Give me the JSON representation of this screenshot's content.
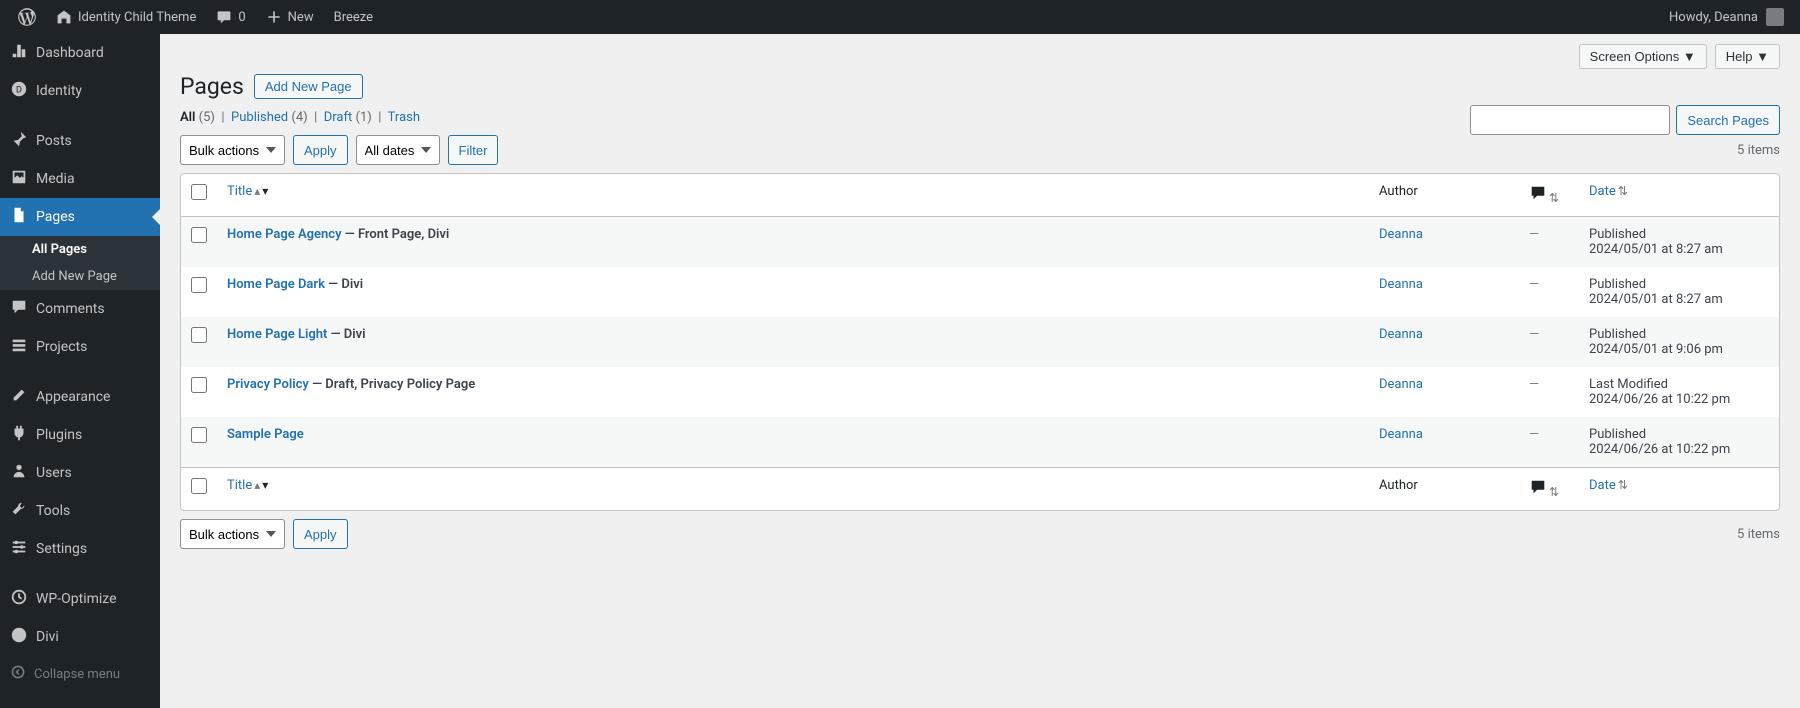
{
  "adminbar": {
    "site_name": "Identity Child Theme",
    "comments": "0",
    "new": "New",
    "breeze": "Breeze",
    "howdy": "Howdy, Deanna"
  },
  "sidebar": {
    "dashboard": "Dashboard",
    "identity": "Identity",
    "posts": "Posts",
    "media": "Media",
    "pages": "Pages",
    "all_pages": "All Pages",
    "add_new_page": "Add New Page",
    "comments": "Comments",
    "projects": "Projects",
    "appearance": "Appearance",
    "plugins": "Plugins",
    "users": "Users",
    "tools": "Tools",
    "settings": "Settings",
    "wp_optimize": "WP-Optimize",
    "divi": "Divi",
    "collapse": "Collapse menu"
  },
  "top": {
    "screen_options": "Screen Options",
    "help": "Help"
  },
  "heading": {
    "title": "Pages",
    "add_new": "Add New Page"
  },
  "filters_links": {
    "all": "All",
    "all_count": "(5)",
    "published": "Published",
    "published_count": "(4)",
    "draft": "Draft",
    "draft_count": "(1)",
    "trash": "Trash"
  },
  "bulk": {
    "bulk_actions": "Bulk actions",
    "apply": "Apply",
    "all_dates": "All dates",
    "filter": "Filter"
  },
  "search": {
    "button": "Search Pages"
  },
  "count": "5 items",
  "columns": {
    "title": "Title",
    "author": "Author",
    "date": "Date"
  },
  "rows": [
    {
      "title": "Home Page Agency",
      "state": " — Front Page, Divi",
      "author": "Deanna",
      "comments": "—",
      "status": "Published",
      "date": "2024/05/01 at 8:27 am"
    },
    {
      "title": "Home Page Dark",
      "state": " — Divi",
      "author": "Deanna",
      "comments": "—",
      "status": "Published",
      "date": "2024/05/01 at 8:27 am"
    },
    {
      "title": "Home Page Light",
      "state": " — Divi",
      "author": "Deanna",
      "comments": "—",
      "status": "Published",
      "date": "2024/05/01 at 9:06 pm"
    },
    {
      "title": "Privacy Policy",
      "state": " — Draft, Privacy Policy Page",
      "author": "Deanna",
      "comments": "—",
      "status": "Last Modified",
      "date": "2024/06/26 at 10:22 pm"
    },
    {
      "title": "Sample Page",
      "state": "",
      "author": "Deanna",
      "comments": "—",
      "status": "Published",
      "date": "2024/06/26 at 10:22 pm"
    }
  ]
}
